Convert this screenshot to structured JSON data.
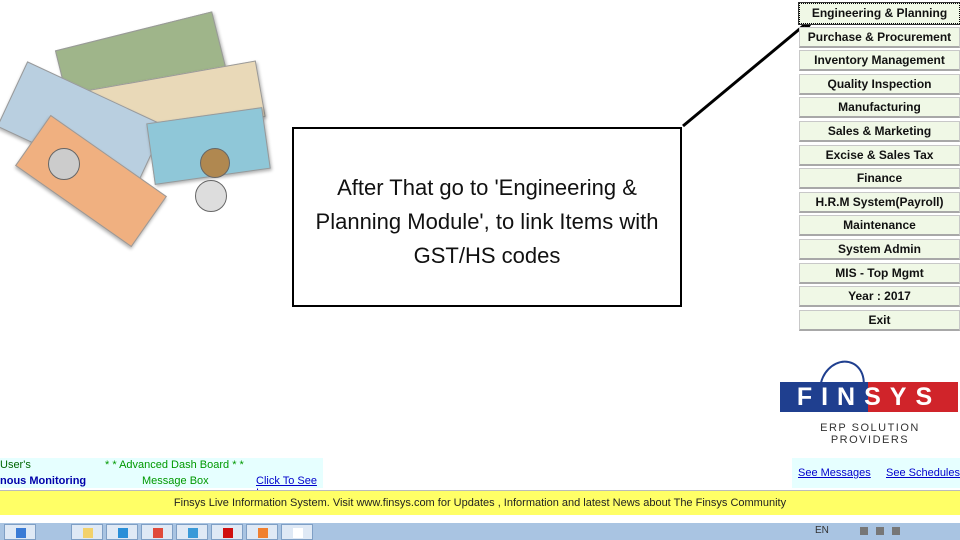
{
  "menu": [
    {
      "label": "Engineering & Planning",
      "focused": true
    },
    {
      "label": "Purchase & Procurement"
    },
    {
      "label": "Inventory Management"
    },
    {
      "label": "Quality Inspection"
    },
    {
      "label": "Manufacturing"
    },
    {
      "label": "Sales & Marketing"
    },
    {
      "label": "Excise & Sales Tax"
    },
    {
      "label": "Finance"
    },
    {
      "label": "H.R.M System(Payroll)"
    },
    {
      "label": "Maintenance"
    },
    {
      "label": "System Admin"
    },
    {
      "label": "MIS - Top Mgmt"
    },
    {
      "label": "Year  : 2017"
    },
    {
      "label": "Exit"
    }
  ],
  "callout": {
    "text": "After That go to 'Engineering & Planning Module', to link Items with GST/HS codes"
  },
  "logo": {
    "brand": "FINSYS",
    "tagline": "ERP SOLUTION PROVIDERS",
    "colors": {
      "blue": "#1f3f8f",
      "red": "#d0242a"
    }
  },
  "dashboard": {
    "users": "User's",
    "monitoring": "nous Monitoring",
    "advanced": "* * Advanced Dash Board * *",
    "message_box": "Message Box",
    "click": "Click To See !",
    "see_messages": "See Messages",
    "see_schedules": "See Schedules"
  },
  "ticker": "Finsys Live Information System. Visit www.finsys.com for Updates , Information and latest News about The Finsys Community",
  "taskbar": {
    "icons": [
      "internet-explorer-icon",
      "folder-icon",
      "skype-icon",
      "chrome-icon",
      "app-icon",
      "record-icon",
      "powerpoint-icon",
      "snipping-tool-icon"
    ],
    "tray_lang": "EN"
  }
}
